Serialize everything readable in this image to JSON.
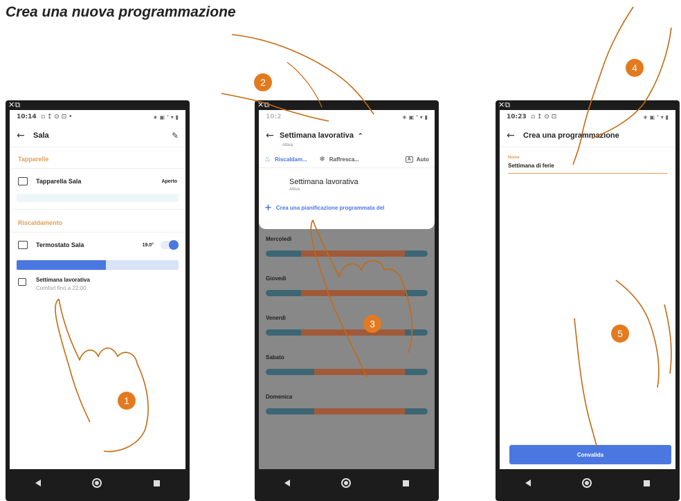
{
  "page": {
    "title": "Crea una nuova programmazione"
  },
  "phone1": {
    "topbar": "✕⧉",
    "status_time": "10:14",
    "status_icons_left": "▫ ↥ ⊙ ⊡ •",
    "status_icons_right": "∗ ▣ ᐩ ▾ ▮",
    "back": "←",
    "title": "Sala",
    "edit_icon": "✎",
    "section_blinds": "Tapparelle",
    "blind_label": "Tapparella Sala",
    "blind_value": "Aperto",
    "section_heating": "Riscaldamento",
    "thermostat_label": "Termostato Sala",
    "thermostat_value": "19.0°",
    "heat_level_pct": 55,
    "program_title": "Settimana lavorativa",
    "program_sub": "Comfort fino a 22:00"
  },
  "phone2": {
    "topbar": "✕⧉",
    "status_time": "10:2",
    "status_icons_right": "∗ ▣ ᐩ ▾ ▮",
    "back": "←",
    "title": "Settimana lavorativa",
    "title_chevron": "⌃",
    "subtitle": "Attiva",
    "tab_heating": "Riscaldam...",
    "tab_cooling": "Raffresca...",
    "tab_auto_box": "A",
    "tab_auto": "Auto",
    "program_title": "Settimana lavorativa",
    "program_sub": "Attiva",
    "create_link": "Crea una pianificazione programmata del",
    "days": [
      {
        "name": "Mercoledì",
        "segments": [
          [
            0.22,
            0.86
          ]
        ]
      },
      {
        "name": "Giovedì",
        "segments": [
          [
            0.22,
            0.86
          ]
        ]
      },
      {
        "name": "Venerdì",
        "segments": [
          [
            0.22,
            0.86
          ]
        ]
      },
      {
        "name": "Sabato",
        "segments": [
          [
            0.3,
            0.86
          ]
        ]
      },
      {
        "name": "Domenica",
        "segments": [
          [
            0.3,
            0.86
          ]
        ]
      }
    ]
  },
  "phone3": {
    "topbar": "✕⧉",
    "status_time": "10:23",
    "status_icons_left": "▫ ↥ ⊙ ⊡",
    "status_icons_right": "∗ ▣ ᐩ ▾ ▮",
    "back": "←",
    "title": "Crea una programmazione",
    "field_label": "Nome",
    "field_value": "Settimana di ferie",
    "button": "Convalida"
  },
  "steps": [
    "1",
    "2",
    "3",
    "4",
    "5"
  ],
  "colors": {
    "accent_blue": "#4a78e0",
    "accent_orange": "#e3a05a",
    "badge_orange": "#e37a1f"
  }
}
